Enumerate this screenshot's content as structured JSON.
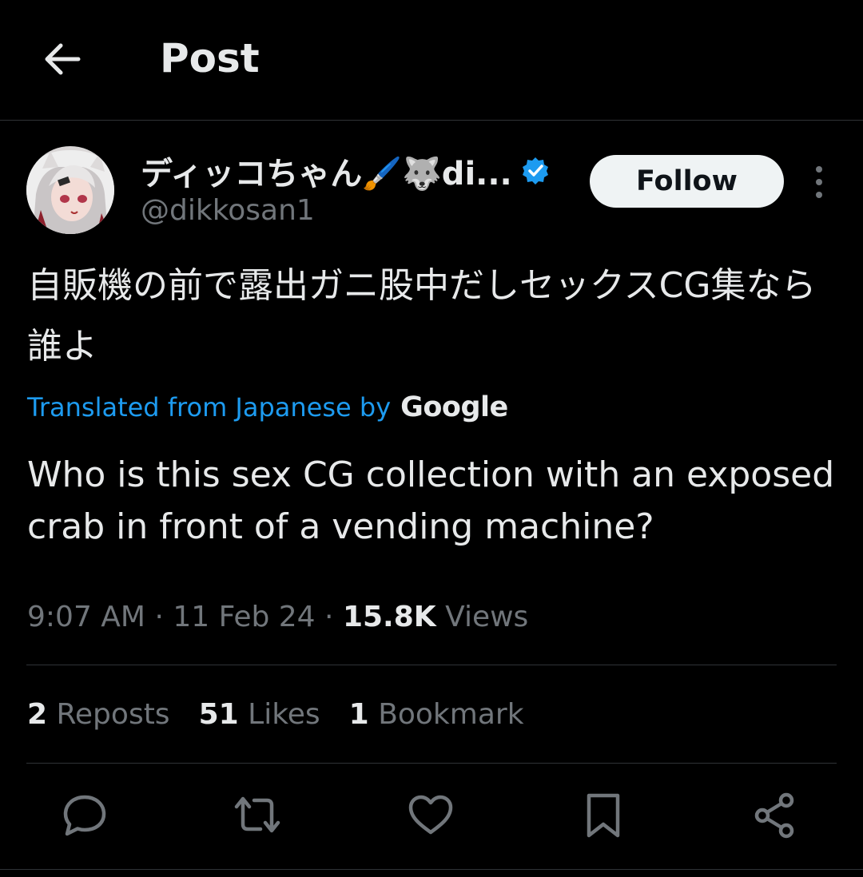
{
  "header": {
    "title": "Post"
  },
  "author": {
    "display_name": "ディッコちゃん🖌️🐺di...",
    "handle": "@dikkosan1",
    "verified": true
  },
  "follow_label": "Follow",
  "post": {
    "text_original": "自販機の前で露出ガニ股中だしセックスCG集なら誰よ",
    "translated_label": "Translated from Japanese by",
    "translator": "Google",
    "text_translated": "Who is this sex CG collection with an exposed crab in front of a vending machine?"
  },
  "meta": {
    "time": "9:07 AM",
    "sep": "·",
    "date": "11 Feb 24",
    "views_count": "15.8K",
    "views_label": "Views"
  },
  "stats": {
    "reposts_count": "2",
    "reposts_label": "Reposts",
    "likes_count": "51",
    "likes_label": "Likes",
    "bookmarks_count": "1",
    "bookmarks_label": "Bookmark"
  },
  "colors": {
    "accent": "#1d9bf0",
    "muted": "#71767b",
    "text": "#e7e9ea",
    "bg": "#000000"
  },
  "icons": [
    "back-arrow-icon",
    "verified-badge-icon",
    "more-icon",
    "reply-icon",
    "repost-icon",
    "like-icon",
    "bookmark-icon",
    "share-icon"
  ]
}
